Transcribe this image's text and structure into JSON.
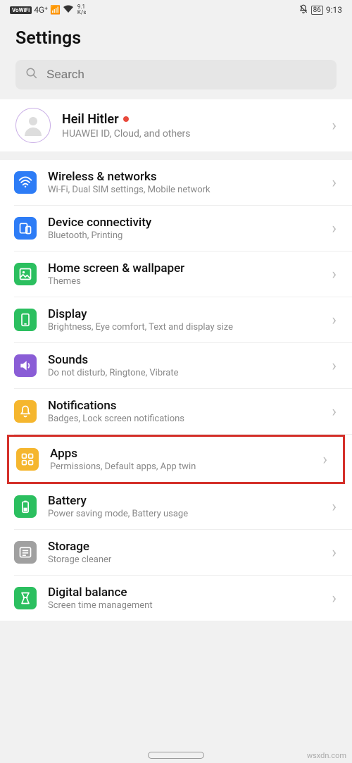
{
  "status": {
    "vowifi": "VoWiFi",
    "signal": "4G⁺",
    "speed_top": "9.1",
    "speed_bottom": "K/s",
    "battery": "86",
    "time": "9:13"
  },
  "header": {
    "title": "Settings"
  },
  "search": {
    "placeholder": "Search"
  },
  "profile": {
    "name": "Heil Hitler",
    "subtitle": "HUAWEI ID, Cloud, and others"
  },
  "items": [
    {
      "icon": "wifi-icon",
      "color": "ic-wifi",
      "title": "Wireless & networks",
      "sub": "Wi-Fi, Dual SIM settings, Mobile network",
      "highlight": false
    },
    {
      "icon": "device-connectivity-icon",
      "color": "ic-device",
      "title": "Device connectivity",
      "sub": "Bluetooth, Printing",
      "highlight": false
    },
    {
      "icon": "home-wallpaper-icon",
      "color": "ic-home",
      "title": "Home screen & wallpaper",
      "sub": "Themes",
      "highlight": false
    },
    {
      "icon": "display-icon",
      "color": "ic-display",
      "title": "Display",
      "sub": "Brightness, Eye comfort, Text and display size",
      "highlight": false
    },
    {
      "icon": "sounds-icon",
      "color": "ic-sound",
      "title": "Sounds",
      "sub": "Do not disturb, Ringtone, Vibrate",
      "highlight": false
    },
    {
      "icon": "notifications-icon",
      "color": "ic-notif",
      "title": "Notifications",
      "sub": "Badges, Lock screen notifications",
      "highlight": false
    },
    {
      "icon": "apps-icon",
      "color": "ic-apps",
      "title": "Apps",
      "sub": "Permissions, Default apps, App twin",
      "highlight": true
    },
    {
      "icon": "battery-icon",
      "color": "ic-battery",
      "title": "Battery",
      "sub": "Power saving mode, Battery usage",
      "highlight": false
    },
    {
      "icon": "storage-icon",
      "color": "ic-storage",
      "title": "Storage",
      "sub": "Storage cleaner",
      "highlight": false
    },
    {
      "icon": "digital-balance-icon",
      "color": "ic-balance",
      "title": "Digital balance",
      "sub": "Screen time management",
      "highlight": false
    }
  ],
  "watermark": "wsxdn.com"
}
